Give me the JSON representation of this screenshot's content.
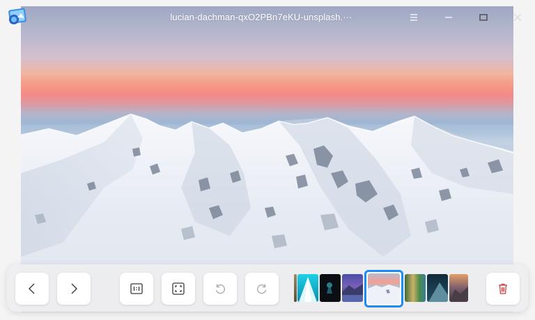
{
  "window": {
    "title": "lucian-dachman-qxO2PBn7eKU-unsplash.···"
  },
  "icons": {
    "app": "image-viewer-app-icon",
    "menu": "hamburger-menu-icon",
    "minimize": "minimize-icon",
    "maximize": "maximize-icon",
    "close": "close-icon",
    "previous": "chevron-left-icon",
    "next": "chevron-right-icon",
    "actual_size": "one-to-one-icon",
    "fit_window": "fit-to-window-icon",
    "rotate_left": "rotate-counterclockwise-icon",
    "rotate_right": "rotate-clockwise-icon",
    "delete": "trash-icon"
  },
  "colors": {
    "accent": "#1b8bf5",
    "delete": "#d33a3a",
    "toolbar_bg": "#eeeef0"
  },
  "thumbnails": [
    {
      "name": "thumb-partial-left",
      "desc": "edge of previous image"
    },
    {
      "name": "thumb-cyan-ice",
      "desc": "cyan ice triangle"
    },
    {
      "name": "thumb-dark-astronaut",
      "desc": "dark scene"
    },
    {
      "name": "thumb-purple-lake",
      "desc": "purple mountain lake"
    },
    {
      "name": "thumb-snow-mountain",
      "desc": "current image",
      "current": true
    },
    {
      "name": "thumb-green-aerial",
      "desc": "green aerial"
    },
    {
      "name": "thumb-dark-teal-peak",
      "desc": "teal mountain"
    },
    {
      "name": "thumb-sunset-peak",
      "desc": "sunset peak"
    }
  ],
  "toolbar": {
    "disabled_buttons": [
      "rotate-left-button",
      "rotate-right-button"
    ]
  }
}
